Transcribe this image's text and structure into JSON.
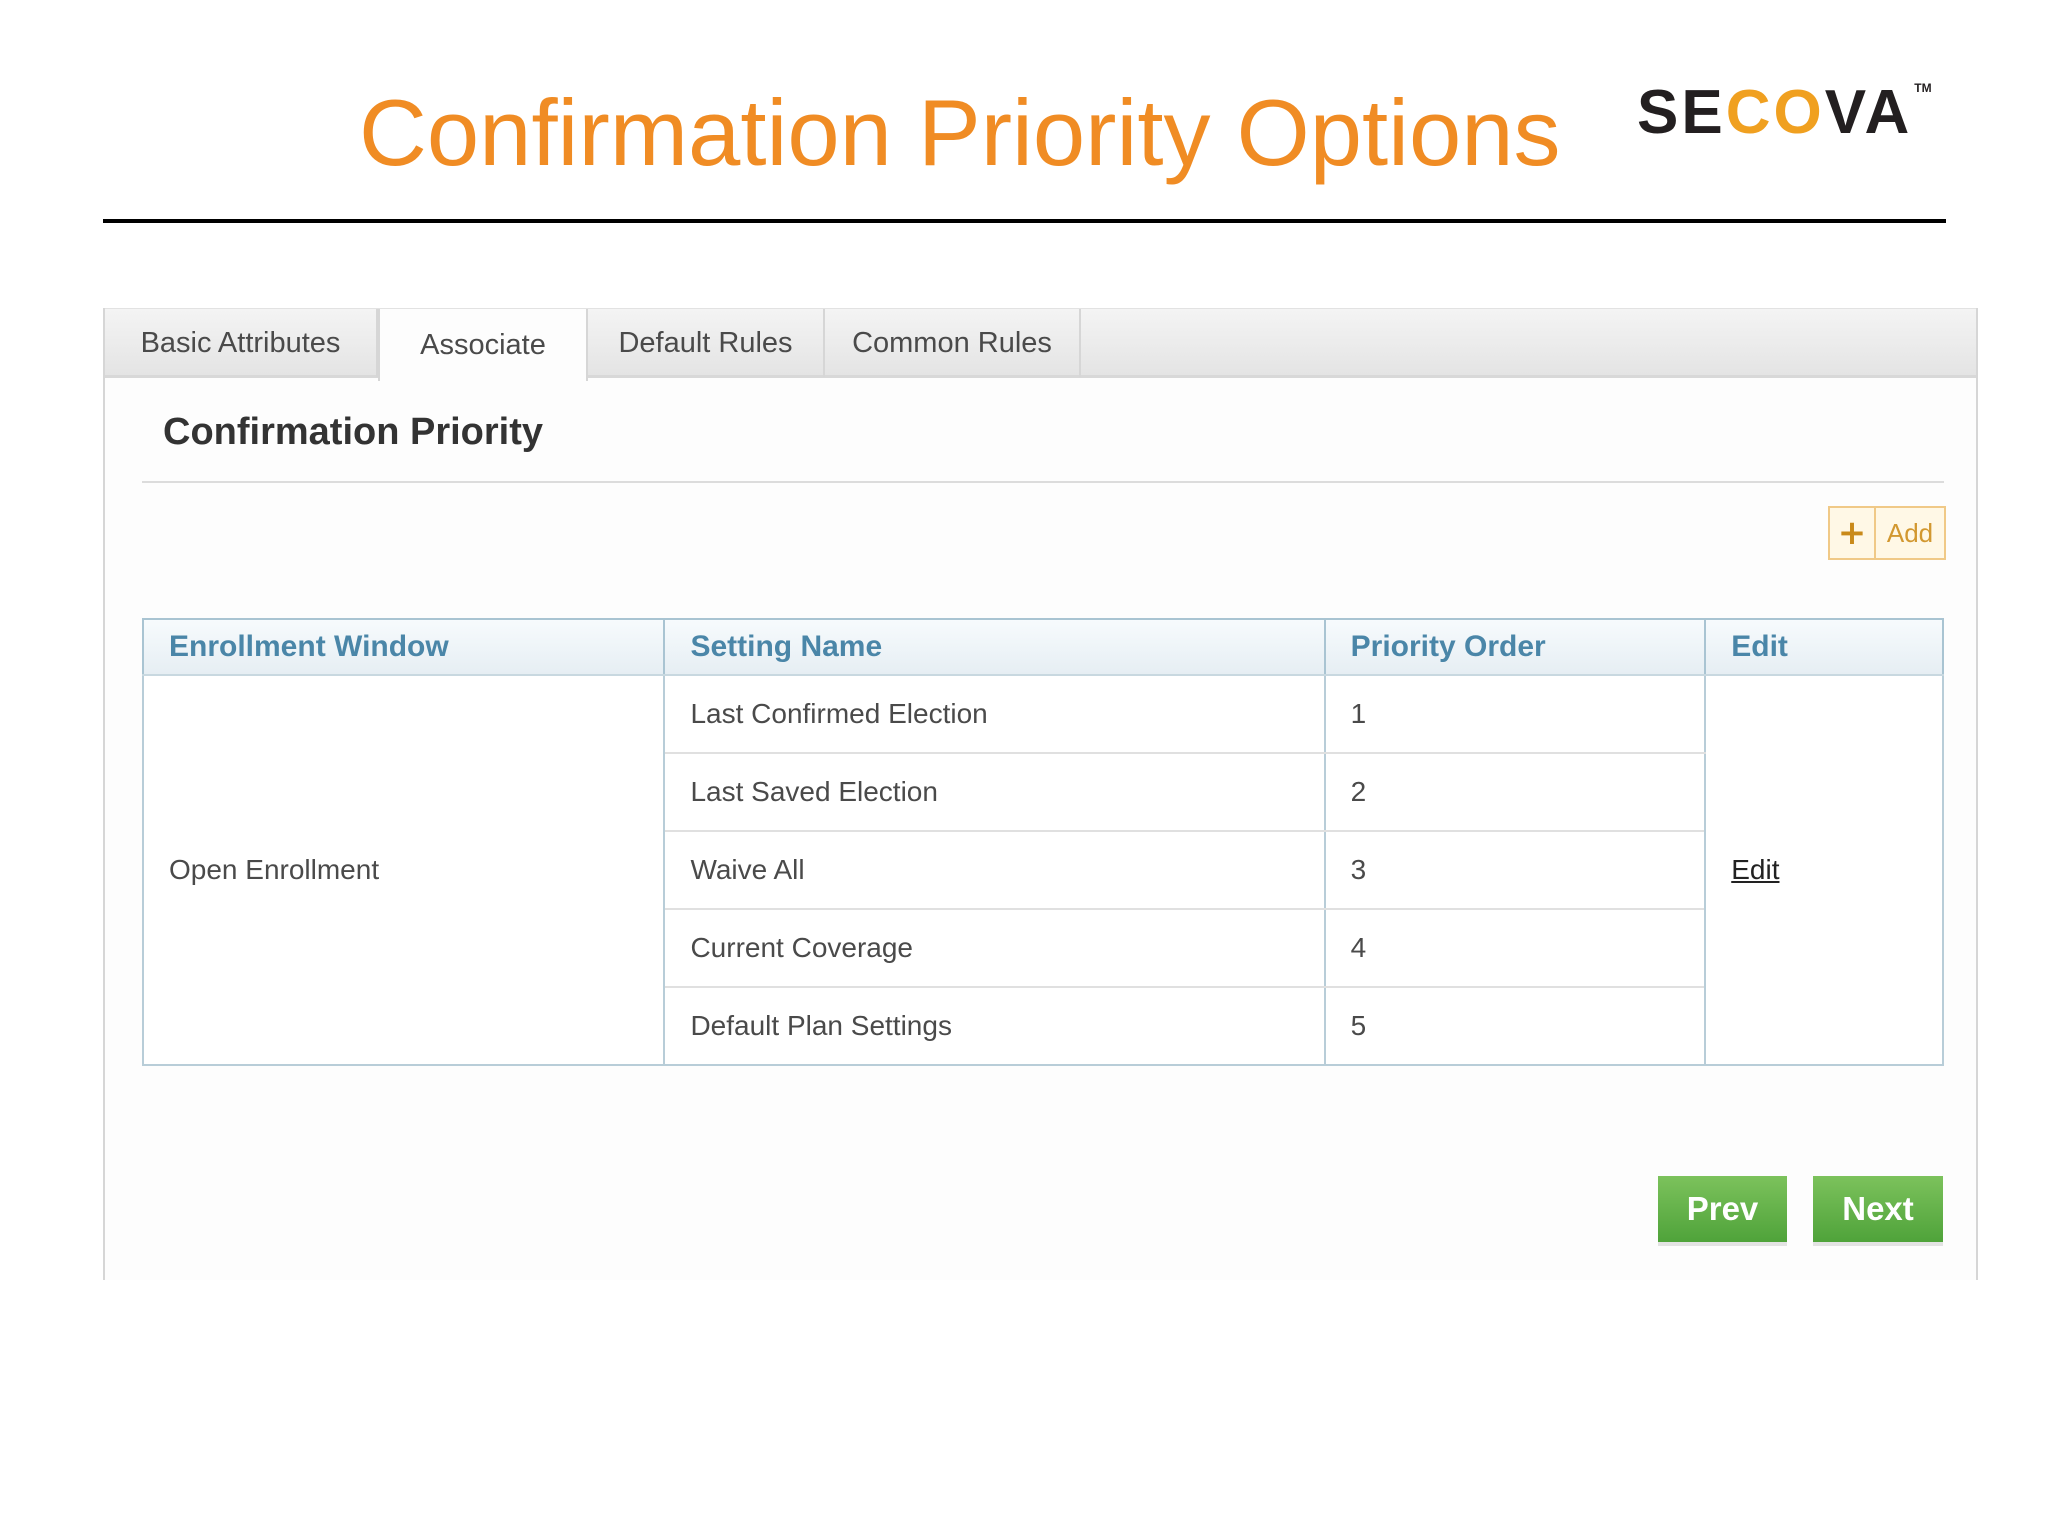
{
  "slide": {
    "title": "Confirmation Priority Options",
    "logo": {
      "text_pre": "SE",
      "text_accent": "CO",
      "text_post": "VA",
      "trademark": "TM"
    }
  },
  "tabs": [
    {
      "label": "Basic Attributes",
      "active": false
    },
    {
      "label": "Associate",
      "active": true
    },
    {
      "label": "Default Rules",
      "active": false
    },
    {
      "label": "Common Rules",
      "active": false
    }
  ],
  "section": {
    "title": "Confirmation Priority",
    "add_label": "Add",
    "add_icon": "plus-icon"
  },
  "table": {
    "headers": [
      "Enrollment Window",
      "Setting Name",
      "Priority Order",
      "Edit"
    ],
    "enrollment_window": "Open Enrollment",
    "edit_label": "Edit",
    "rows": [
      {
        "setting_name": "Last Confirmed Election",
        "priority": "1"
      },
      {
        "setting_name": "Last Saved Election",
        "priority": "2"
      },
      {
        "setting_name": "Waive All",
        "priority": "3"
      },
      {
        "setting_name": "Current Coverage",
        "priority": "4"
      },
      {
        "setting_name": "Default Plan Settings",
        "priority": "5"
      }
    ]
  },
  "nav": {
    "prev_label": "Prev",
    "next_label": "Next"
  },
  "colors": {
    "title_orange": "#F08C24",
    "header_blue": "#4A86A8",
    "button_green": "#5BAE45",
    "add_border": "#F0C987"
  }
}
